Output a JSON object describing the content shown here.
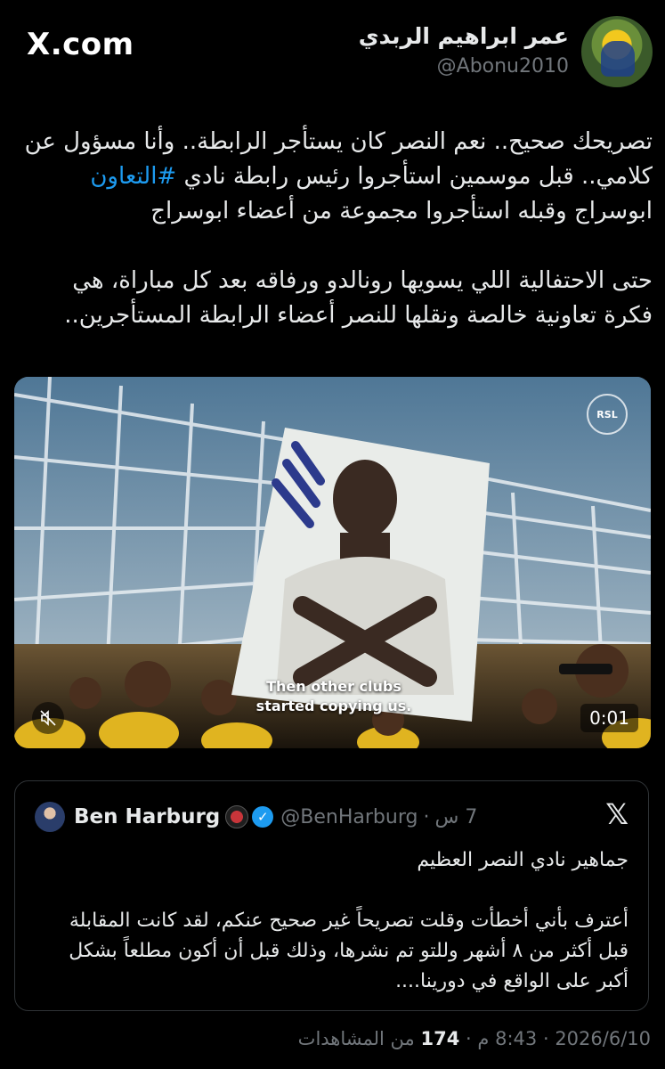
{
  "brand": {
    "label": "X.com"
  },
  "author": {
    "name": "عمر ابراهيم الربدي",
    "handle": "@Abonu2010"
  },
  "post": {
    "para1_before_hashtag": "تصريحك صحيح.. نعم النصر كان يستأجر الرابطة.. وأنا مسؤول عن كلامي.. قبل موسمين استأجروا رئيس رابطة نادي ",
    "hashtag": "#التعاون",
    "para1_after_hashtag": " ابوسراج وقبله استأجروا مجموعة من أعضاء ابوسراج",
    "para2": "حتى الاحتفالية اللي يسويها رونالدو ورفاقه بعد كل مباراة، هي فكرة تعاونية خالصة ونقلها للنصر أعضاء الرابطة المستأجرين.."
  },
  "video": {
    "watermark": "RSL",
    "caption_line1": "Then other clubs",
    "caption_line2": "started copying us.",
    "timestamp": "0:01",
    "mute_icon": "speaker-muted-icon"
  },
  "quote": {
    "name": "Ben Harburg",
    "handle": "@BenHarburg",
    "separator": "·",
    "time": "7 س",
    "para1": "جماهير نادي النصر العظيم",
    "para2": "أعترف بأني أخطأت وقلت تصريحاً غير صحيح عنكم، لقد كانت المقابلة قبل أكثر من ٨ أشهر وللتو تم نشرها، وذلك قبل أن أكون مطلعاً بشكل أكبر على الواقع في دورينا...."
  },
  "footer": {
    "date": "2026/6/10",
    "dot": "·",
    "time": "8:43 م",
    "views_count": "174",
    "views_label": "من المشاهدات"
  },
  "colors": {
    "background": "#000000",
    "text": "#e7e9ea",
    "muted": "#71767b",
    "link": "#1d9bf0",
    "border": "#2f3336"
  }
}
